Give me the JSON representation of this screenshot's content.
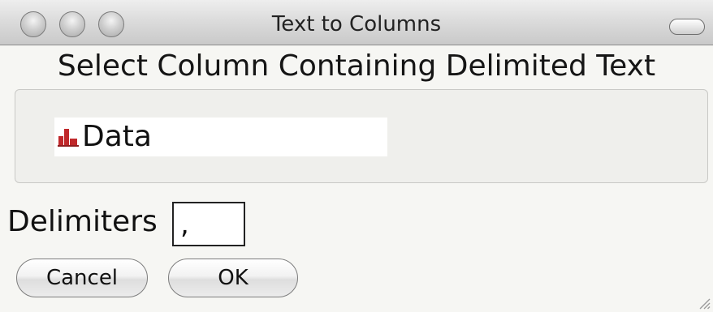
{
  "window": {
    "title": "Text to Columns"
  },
  "heading": "Select Column Containing Delimited Text",
  "columns": [
    {
      "label": "Data",
      "icon": "column-icon",
      "icon_color": "#c0282b"
    }
  ],
  "delimiters": {
    "label": "Delimiters",
    "value": ","
  },
  "buttons": {
    "cancel_label": "Cancel",
    "ok_label": "OK"
  }
}
